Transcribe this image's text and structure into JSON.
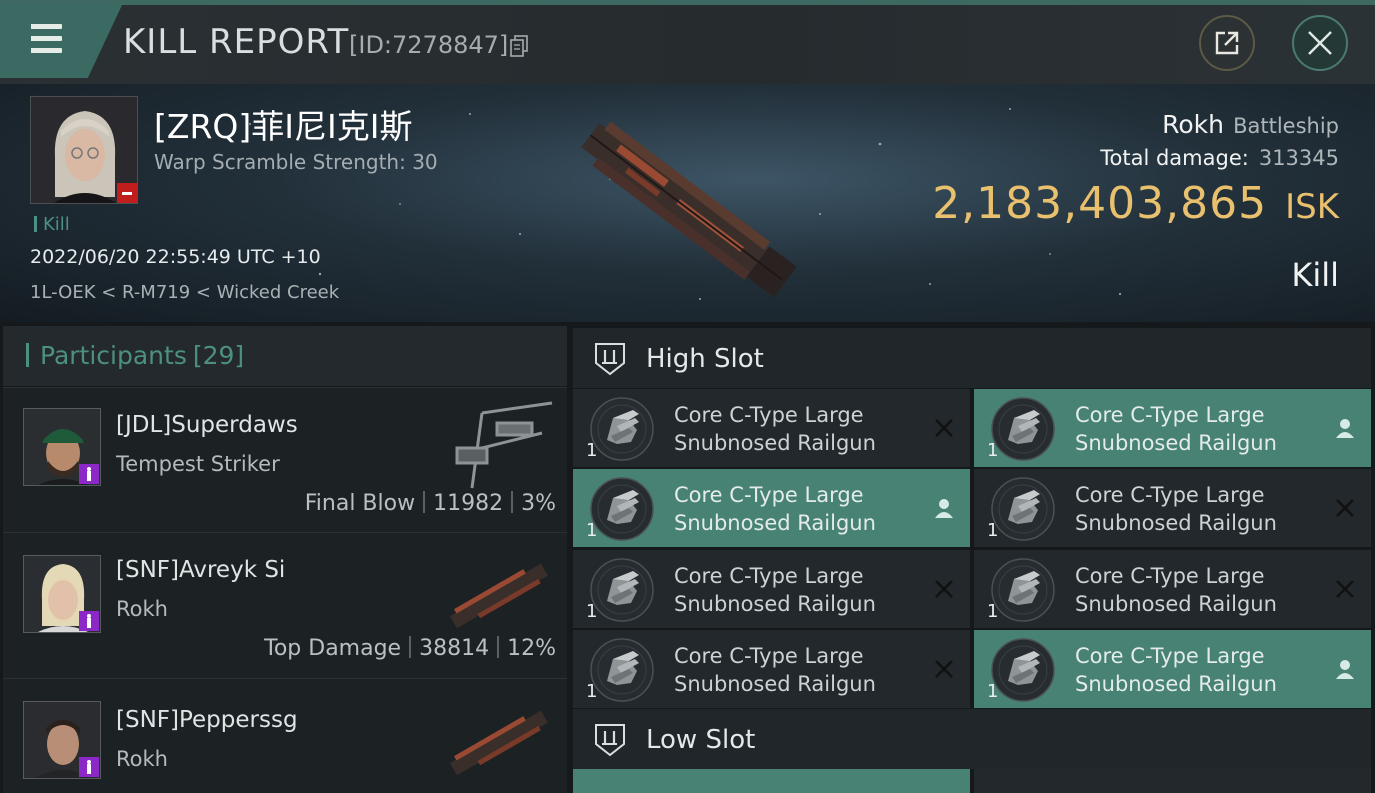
{
  "header": {
    "title": "KILL REPORT",
    "report_id": "[ID:7278847]",
    "icons": {
      "menu": "hamburger-menu-icon",
      "copy": "copy-icon",
      "share": "share-external-icon",
      "close": "close-icon"
    }
  },
  "victim": {
    "name": "[ZRQ]菲I尼I克I斯",
    "warp_scramble": "Warp Scramble Strength: 30",
    "tag": "Kill",
    "datetime": "2022/06/20 22:55:49 UTC +10",
    "location": "1L-OEK < R-M719 < Wicked Creek",
    "ship_name": "Rokh",
    "ship_class": "Battleship",
    "total_damage_label": "Total damage:",
    "total_damage": "313345",
    "isk_value": "2,183,403,865",
    "isk_unit": "ISK",
    "result": "Kill"
  },
  "participants": {
    "label": "Participants",
    "count": "[29]",
    "rows": [
      {
        "name": "[JDL]Superdaws",
        "ship": "Tempest Striker",
        "stat_label": "Final Blow",
        "damage": "11982",
        "percent": "3%"
      },
      {
        "name": "[SNF]Avreyk Si",
        "ship": "Rokh",
        "stat_label": "Top Damage",
        "damage": "38814",
        "percent": "12%"
      },
      {
        "name": "[SNF]Pepperssg",
        "ship": "Rokh",
        "stat_label": "",
        "damage": "",
        "percent": ""
      }
    ]
  },
  "high_slot": {
    "label": "High Slot",
    "modules": [
      {
        "line1": "Core C-Type Large",
        "line2": "Snubnosed Railgun",
        "qty": "1",
        "status": "destroyed"
      },
      {
        "line1": "Core C-Type Large",
        "line2": "Snubnosed Railgun",
        "qty": "1",
        "status": "dropped"
      },
      {
        "line1": "Core C-Type Large",
        "line2": "Snubnosed Railgun",
        "qty": "1",
        "status": "dropped"
      },
      {
        "line1": "Core C-Type Large",
        "line2": "Snubnosed Railgun",
        "qty": "1",
        "status": "destroyed"
      },
      {
        "line1": "Core C-Type Large",
        "line2": "Snubnosed Railgun",
        "qty": "1",
        "status": "destroyed"
      },
      {
        "line1": "Core C-Type Large",
        "line2": "Snubnosed Railgun",
        "qty": "1",
        "status": "destroyed"
      },
      {
        "line1": "Core C-Type Large",
        "line2": "Snubnosed Railgun",
        "qty": "1",
        "status": "destroyed"
      },
      {
        "line1": "Core C-Type Large",
        "line2": "Snubnosed Railgun",
        "qty": "1",
        "status": "dropped"
      }
    ]
  },
  "low_slot": {
    "label": "Low Slot"
  },
  "colors": {
    "accent_teal": "#4c8f83",
    "fitted_bg": "#478275",
    "isk_gold": "#e9c06e",
    "warning_red": "#c01d1d",
    "badge_purple": "#8c28c8"
  }
}
